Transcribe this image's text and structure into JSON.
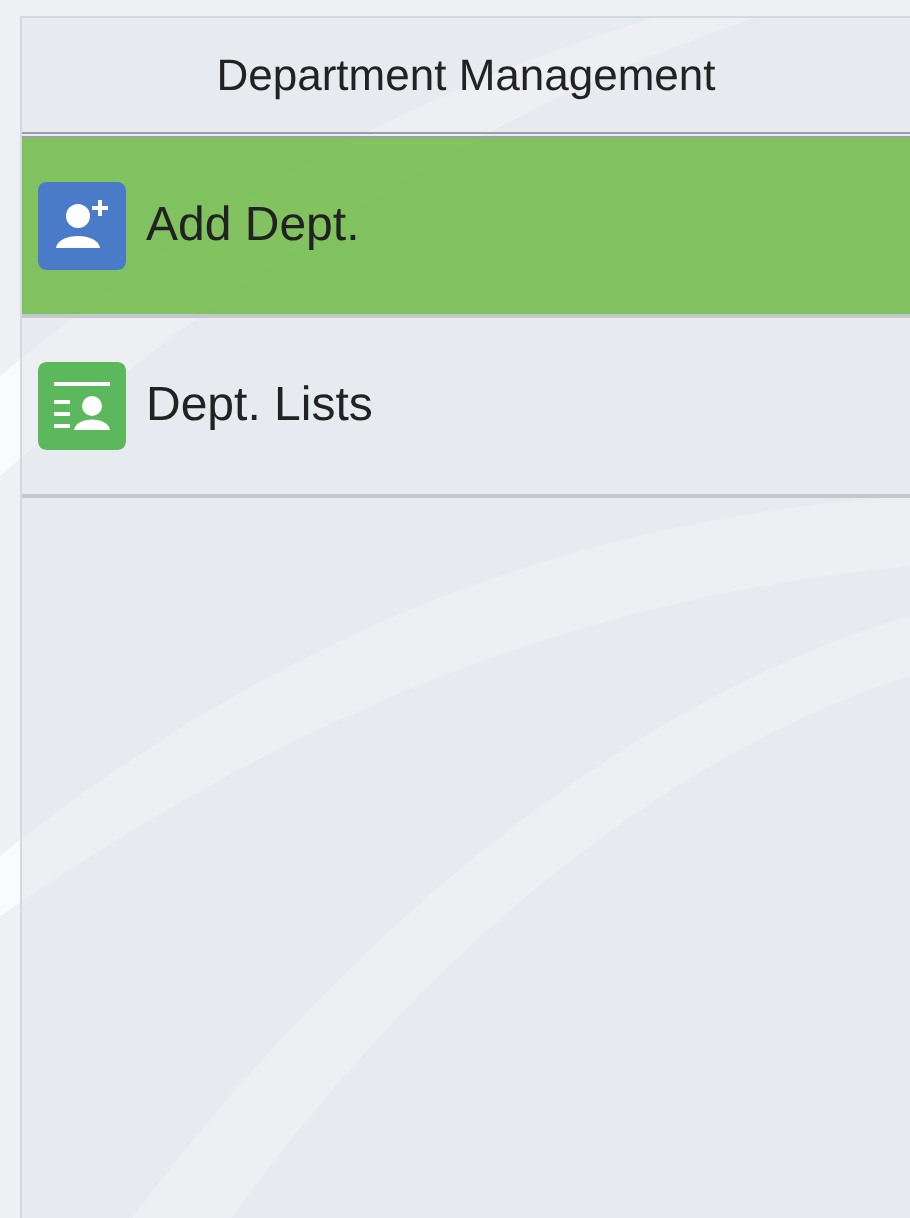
{
  "header": {
    "title": "Department Management"
  },
  "items": [
    {
      "label": "Add Dept.",
      "kind": "add",
      "selected": true
    },
    {
      "label": "Dept. Lists",
      "kind": "list",
      "selected": false
    }
  ]
}
